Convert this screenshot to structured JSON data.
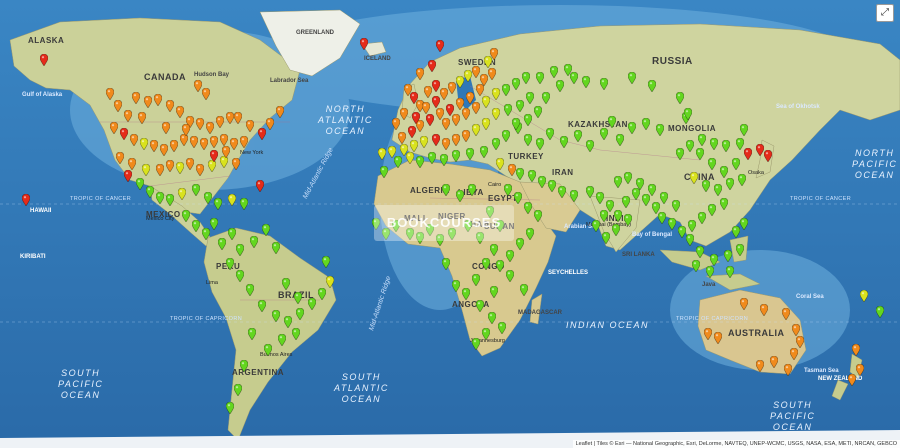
{
  "map": {
    "countries": [
      "ALASKA",
      "CANADA",
      "RUSSIA",
      "KAZAKHSTAN",
      "MONGOLIA",
      "CHINA",
      "INDIA",
      "ALGERIA",
      "LIBYA",
      "EGYPT",
      "SUDAN",
      "BRAZIL",
      "ARGENTINA",
      "AUSTRALIA",
      "ANGOLA",
      "NIGER",
      "CHAD",
      "MALI",
      "MEXICO",
      "PERU",
      "IRAN",
      "TURKEY",
      "SWEDEN",
      "CONGO"
    ],
    "oceans": [
      "NORTH\nATLANTIC\nOCEAN",
      "SOUTH\nATLANTIC\nOCEAN",
      "INDIAN OCEAN",
      "SOUTH\nPACIFIC\nOCEAN",
      "NORTH\nPACIFIC\nOCEAN",
      "SOUTH\nPACIFIC\nOCEAN"
    ],
    "ridges": [
      "Mid-Atlantic Ridge",
      "Mid-Atlantic Ridge"
    ],
    "tropics": [
      "TROPIC OF CANCER",
      "TROPIC OF CAPRICORN",
      "TROPIC OF CANCER",
      "TROPIC OF CAPRICORN"
    ],
    "small_labels": [
      "Hudson Bay",
      "Labrador Sea",
      "Gulf of Alaska",
      "Sea of Okhotsk",
      "Arabian Sea",
      "Bay of Bengal",
      "Coral Sea",
      "Tasman Sea",
      "NEW ZEALAND",
      "HAWAII",
      "KIRIBATI",
      "MADAGASCAR",
      "Java",
      "SEYCHELLES",
      "SRI LANKA",
      "GREENLAND",
      "ICELAND"
    ],
    "cities": [
      "New York",
      "Mexico City",
      "Cairo",
      "Mumbai (Bombay)",
      "Osaka",
      "Johannesburg",
      "Buenos Aires",
      "Lima"
    ],
    "zoom_label": "⤢",
    "watermark": "BOOKCOURSES",
    "attribution": "Leaflet | Tiles © Esri — National Geographic, Esri, DeLorme, NAVTEQ, UNEP-WCMC, USGS, NASA, ESA, METI, NRCAN, GEBCO"
  },
  "colors": {
    "ocean": "#2f78b8",
    "land": "#c9cf9a",
    "pin_red": "#e52b1a",
    "pin_orange": "#f08a1c",
    "pin_yellow": "#d9e21e",
    "pin_green": "#63d61f"
  }
}
